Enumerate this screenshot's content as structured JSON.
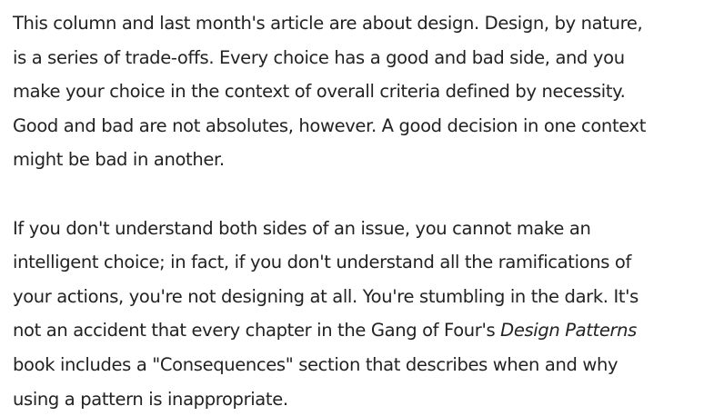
{
  "article": {
    "paragraph1": [
      "This column and last month's article are about design. Design, by nature,",
      "is a series of trade-offs. Every choice has a good and bad side, and you",
      "make your choice in the context of overall criteria defined by necessity.",
      "Good and bad are not absolutes, however. A good decision in one context",
      "might be bad in another."
    ],
    "paragraph2": {
      "line1": "If you don't understand both sides of an issue, you cannot make an",
      "line2": "intelligent choice; in fact, if you don't understand all the ramifications of",
      "line3": "your actions, you're not designing at all. You're stumbling in the dark. It's",
      "line4_before_title": "not an accident that every chapter in the Gang of Four's ",
      "book_title": "Design Patterns",
      "line5": "book includes a \"Consequences\" section that describes when and why",
      "line6": "using a pattern is inappropriate."
    }
  }
}
